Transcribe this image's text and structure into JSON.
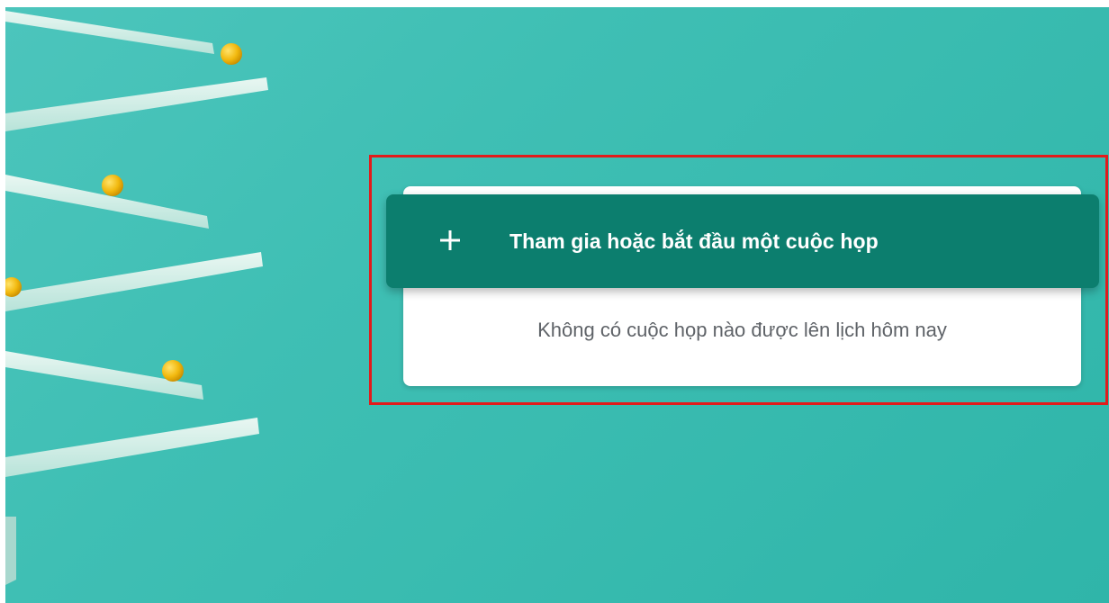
{
  "meeting_panel": {
    "join_button": {
      "icon": "plus-icon",
      "label": "Tham gia hoặc bắt đầu một cuộc họp"
    },
    "empty_state_text": "Không có cuộc họp nào được lên lịch hôm nay"
  },
  "colors": {
    "background": "#3fbfb4",
    "join_button": "#0c7e6e",
    "card": "#ffffff",
    "highlight": "#e21b1b",
    "ball": "#f2b90f"
  }
}
